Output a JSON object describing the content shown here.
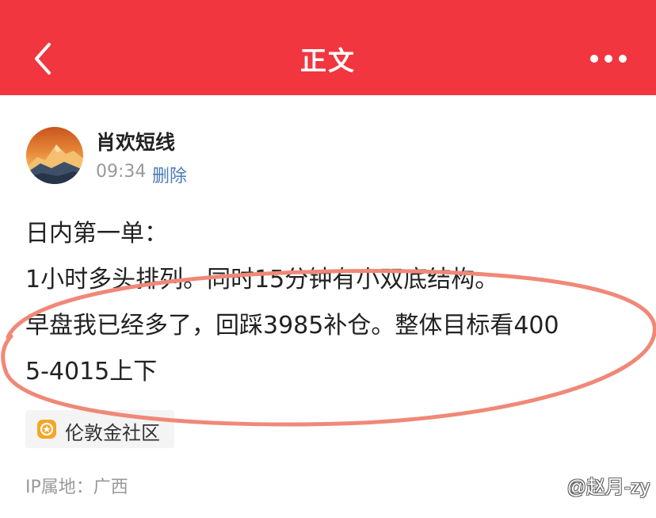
{
  "header": {
    "title": "正文",
    "back_icon": "chevron-left-icon",
    "more_icon": "more-horizontal-icon",
    "background_color": "#f1363f"
  },
  "author": {
    "name": "肖欢短线",
    "time": "09:34",
    "delete_label": "删除",
    "avatar_icon": "mountain-sunset-avatar"
  },
  "post": {
    "lines": [
      "日内第一单：",
      "1小时多头排列。同时15分钟有小双底结构。",
      "早盘我已经多了，回踩3985补仓。整体目标看400",
      "5-4015上下"
    ]
  },
  "tag": {
    "label": "伦敦金社区",
    "icon": "community-badge-icon",
    "icon_color": "#f5a623"
  },
  "ip_location": "IP属地：广西",
  "watermark": "@赵月-zy",
  "annotation": {
    "color": "#f08878"
  }
}
